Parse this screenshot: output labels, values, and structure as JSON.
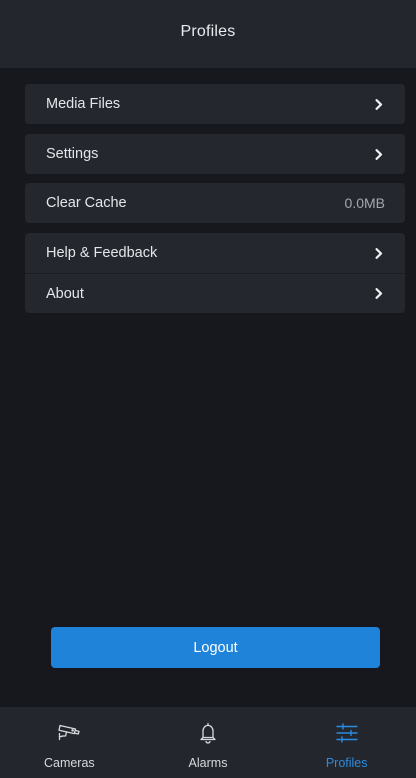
{
  "header": {
    "title": "Profiles"
  },
  "menu": {
    "media_files": {
      "label": "Media Files",
      "icon": "chevron-right-icon"
    },
    "settings": {
      "label": "Settings",
      "icon": "chevron-right-icon"
    },
    "clear_cache": {
      "label": "Clear Cache",
      "value": "0.0MB"
    },
    "help_feedback": {
      "label": "Help & Feedback",
      "icon": "chevron-right-icon"
    },
    "about": {
      "label": "About",
      "icon": "chevron-right-icon"
    }
  },
  "logout": {
    "label": "Logout"
  },
  "tabbar": {
    "tabs": [
      {
        "label": "Cameras",
        "icon": "cctv-camera-icon",
        "active": false
      },
      {
        "label": "Alarms",
        "icon": "bell-icon",
        "active": false
      },
      {
        "label": "Profiles",
        "icon": "sliders-icon",
        "active": true
      }
    ]
  },
  "colors": {
    "background": "#16181d",
    "surface": "#24272e",
    "header": "#23262d",
    "accent": "#1e83d9",
    "active_tab": "#2a8ce0",
    "text": "#e4e6ea",
    "muted_text": "#a3a7ae"
  }
}
